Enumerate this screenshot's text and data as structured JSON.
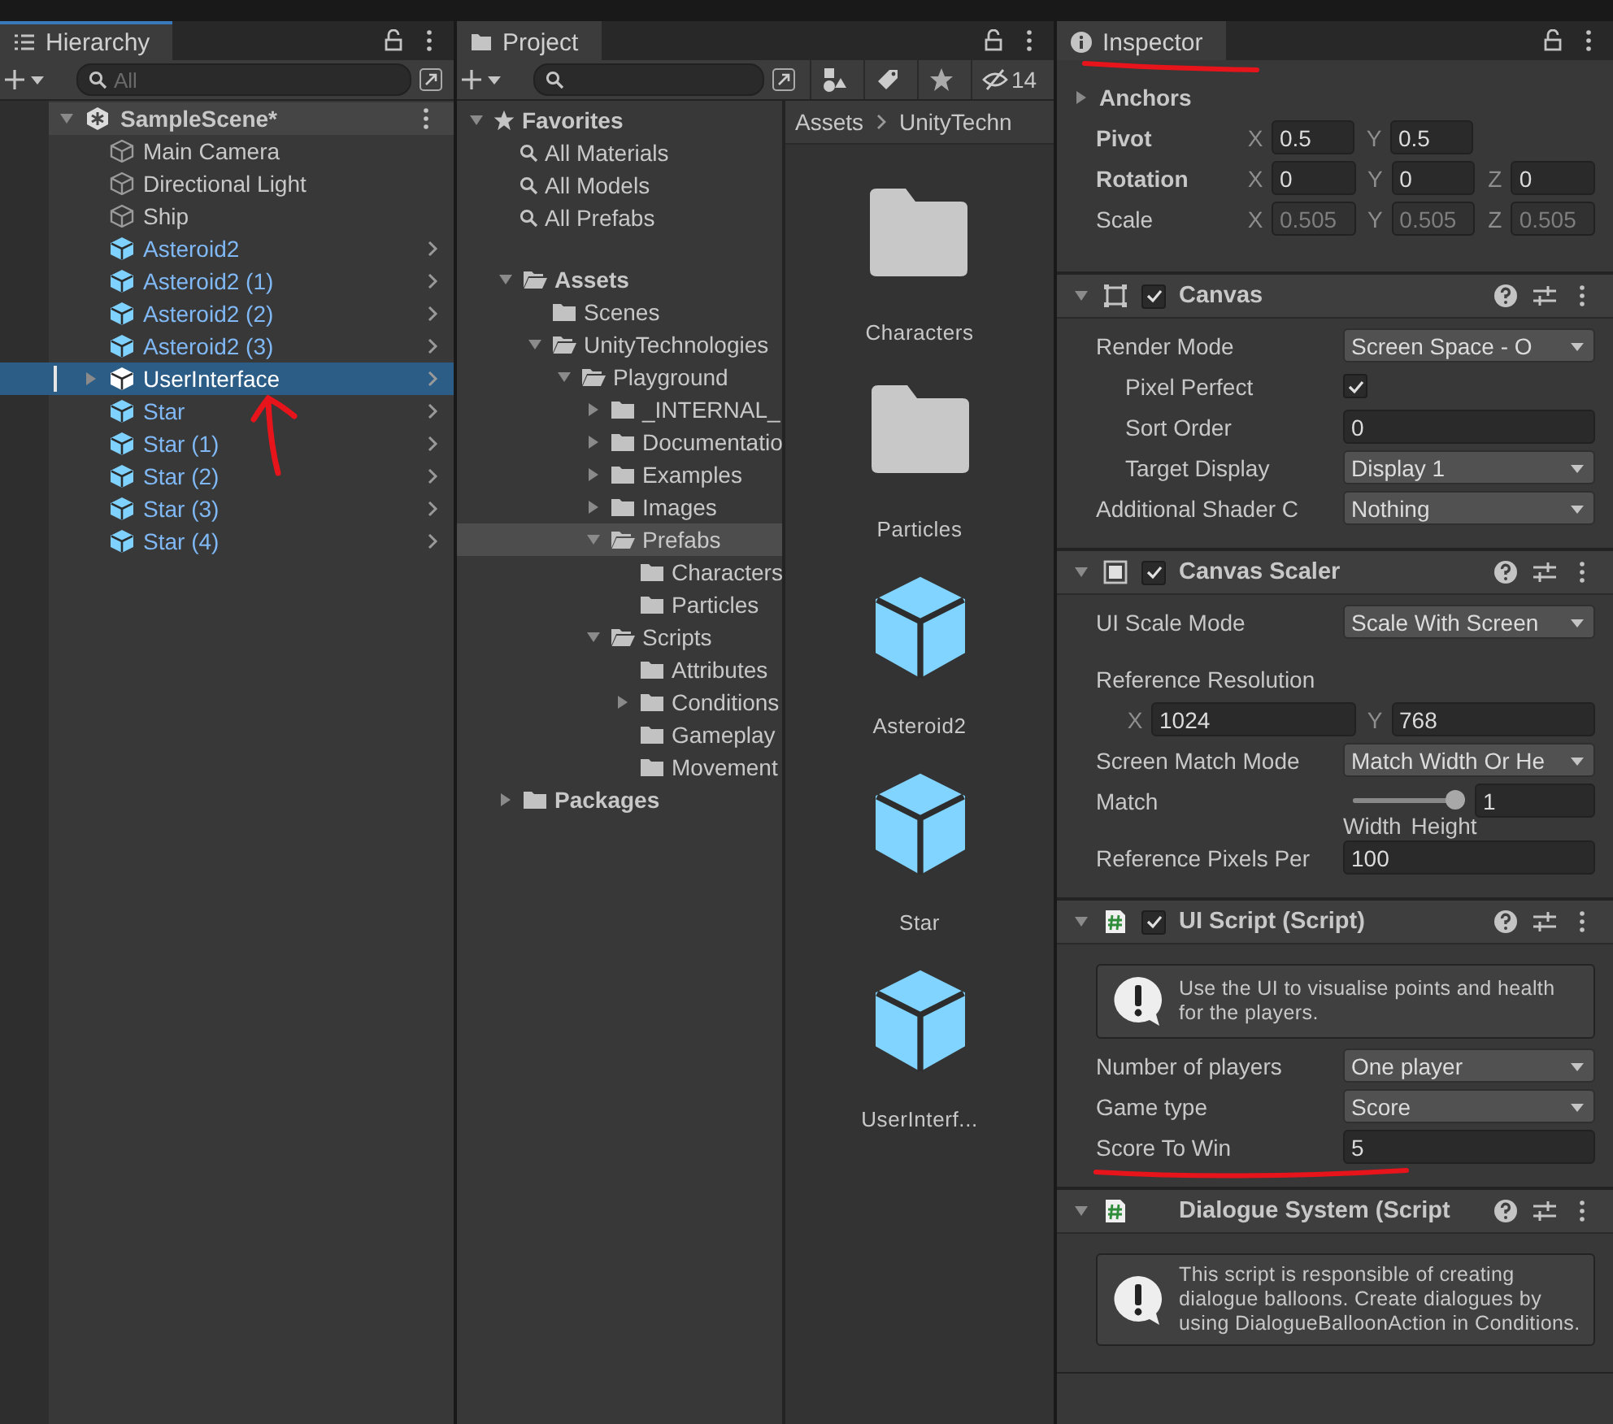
{
  "hierarchy": {
    "title": "Hierarchy",
    "focused": true,
    "search_placeholder": "All",
    "scene": {
      "name": "SampleScene*",
      "expanded": true
    },
    "items": [
      {
        "name": "Main Camera",
        "kind": "object",
        "selected": false,
        "has_children": false
      },
      {
        "name": "Directional Light",
        "kind": "object",
        "selected": false,
        "has_children": false
      },
      {
        "name": "Ship",
        "kind": "object",
        "selected": false,
        "has_children": false
      },
      {
        "name": "Asteroid2",
        "kind": "prefab",
        "selected": false,
        "has_children": false
      },
      {
        "name": "Asteroid2 (1)",
        "kind": "prefab",
        "selected": false,
        "has_children": false
      },
      {
        "name": "Asteroid2 (2)",
        "kind": "prefab",
        "selected": false,
        "has_children": false
      },
      {
        "name": "Asteroid2 (3)",
        "kind": "prefab",
        "selected": false,
        "has_children": false
      },
      {
        "name": "UserInterface",
        "kind": "prefab",
        "selected": true,
        "has_children": true
      },
      {
        "name": "Star",
        "kind": "prefab",
        "selected": false,
        "has_children": false
      },
      {
        "name": "Star (1)",
        "kind": "prefab",
        "selected": false,
        "has_children": false
      },
      {
        "name": "Star (2)",
        "kind": "prefab",
        "selected": false,
        "has_children": false
      },
      {
        "name": "Star (3)",
        "kind": "prefab",
        "selected": false,
        "has_children": false
      },
      {
        "name": "Star (4)",
        "kind": "prefab",
        "selected": false,
        "has_children": false
      }
    ]
  },
  "project": {
    "title": "Project",
    "focused": false,
    "hidden_count": "14",
    "favorites": {
      "label": "Favorites",
      "expanded": true,
      "items": [
        "All Materials",
        "All Models",
        "All Prefabs"
      ]
    },
    "tree": [
      {
        "name": "Assets",
        "expanded": true,
        "selected": false,
        "children": [
          {
            "name": "Scenes",
            "selected": false
          },
          {
            "name": "UnityTechnologies",
            "expanded": true,
            "selected": false,
            "children": [
              {
                "name": "Playground",
                "expanded": true,
                "selected": false,
                "children": [
                  {
                    "name": "_INTERNAL_",
                    "expanded": false,
                    "selected": false
                  },
                  {
                    "name": "Documentatio",
                    "expanded": false,
                    "selected": false
                  },
                  {
                    "name": "Examples",
                    "expanded": false,
                    "selected": false
                  },
                  {
                    "name": "Images",
                    "expanded": false,
                    "selected": false
                  },
                  {
                    "name": "Prefabs",
                    "expanded": true,
                    "selected": true,
                    "children": [
                      {
                        "name": "Characters",
                        "selected": false
                      },
                      {
                        "name": "Particles",
                        "selected": false
                      }
                    ]
                  },
                  {
                    "name": "Scripts",
                    "expanded": true,
                    "selected": false,
                    "children": [
                      {
                        "name": "Attributes",
                        "selected": false
                      },
                      {
                        "name": "Conditions",
                        "expanded": false,
                        "selected": false
                      },
                      {
                        "name": "Gameplay",
                        "selected": false
                      },
                      {
                        "name": "Movement",
                        "selected": false
                      }
                    ]
                  }
                ]
              }
            ]
          }
        ]
      },
      {
        "name": "Packages",
        "expanded": false,
        "selected": false
      }
    ],
    "breadcrumb": [
      "Assets",
      "UnityTechn"
    ],
    "assets": [
      {
        "name": "Characters",
        "kind": "folder"
      },
      {
        "name": "Particles",
        "kind": "folder"
      },
      {
        "name": "Asteroid2",
        "kind": "prefab"
      },
      {
        "name": "Star",
        "kind": "prefab"
      },
      {
        "name": "UserInterf...",
        "kind": "prefab"
      }
    ]
  },
  "inspector": {
    "title": "Inspector",
    "focused": false,
    "marked": true,
    "transform": [
      {
        "kind": "foldout",
        "label": "Anchors",
        "expanded": false
      },
      {
        "kind": "vector",
        "label": "Pivot",
        "overridden": true,
        "disabled": false,
        "axes": [
          "X",
          "Y"
        ],
        "values": [
          "0.5",
          "0.5"
        ]
      },
      {
        "kind": "vector",
        "label": "Rotation",
        "overridden": true,
        "disabled": false,
        "axes": [
          "X",
          "Y",
          "Z"
        ],
        "values": [
          "0",
          "0",
          "0"
        ]
      },
      {
        "kind": "vector",
        "label": "Scale",
        "overridden": false,
        "disabled": true,
        "axes": [
          "X",
          "Y",
          "Z"
        ],
        "values": [
          "0.505",
          "0.505",
          "0.505"
        ]
      }
    ],
    "components": [
      {
        "title": "Canvas",
        "kind": "canvas",
        "enabled": true,
        "expanded": true,
        "fields": [
          {
            "kind": "dropdown",
            "label": "Render Mode",
            "value": "Screen Space - O",
            "children": [
              {
                "kind": "checkbox",
                "label": "Pixel Perfect",
                "checked": true
              },
              {
                "kind": "number",
                "label": "Sort Order",
                "value": "0"
              },
              {
                "kind": "dropdown",
                "label": "Target Display",
                "value": "Display 1"
              }
            ]
          },
          {
            "kind": "dropdown",
            "label": "Additional Shader C",
            "value": "Nothing"
          }
        ]
      },
      {
        "title": "Canvas Scaler",
        "kind": "scaler",
        "enabled": true,
        "expanded": true,
        "fields": [
          {
            "kind": "dropdown",
            "label": "UI Scale Mode",
            "value": "Scale With Screen"
          },
          {
            "kind": "heading",
            "label": "Reference Resolution",
            "children": [
              {
                "kind": "vector",
                "axes": [
                  "X",
                  "Y"
                ],
                "values": [
                  "1024",
                  "768"
                ],
                "disabled": false
              }
            ]
          },
          {
            "kind": "dropdown",
            "label": "Screen Match Mode",
            "value": "Match Width Or He"
          },
          {
            "kind": "slider",
            "label": "Match",
            "level": 1,
            "value": "1",
            "min_label": "Width",
            "max_label": "Height"
          },
          {
            "kind": "number",
            "label": "Reference Pixels Per",
            "value": "100"
          }
        ]
      },
      {
        "title": "UI Script (Script)",
        "kind": "script",
        "enabled": true,
        "expanded": true,
        "fields": [
          {
            "kind": "help",
            "text": "Use the UI to visualise points and health for the players."
          },
          {
            "kind": "dropdown",
            "label": "Number of players",
            "value": "One player"
          },
          {
            "kind": "dropdown",
            "label": "Game type",
            "value": "Score"
          },
          {
            "kind": "number",
            "label": "Score To Win",
            "value": "5",
            "marked": true
          }
        ]
      },
      {
        "title": "Dialogue System (Script",
        "kind": "script",
        "expanded": true,
        "fields": [
          {
            "kind": "help",
            "text": "This script is responsible of creating dialogue balloons. Create dialogues by using DialogueBalloonAction in Conditions."
          }
        ]
      }
    ]
  }
}
